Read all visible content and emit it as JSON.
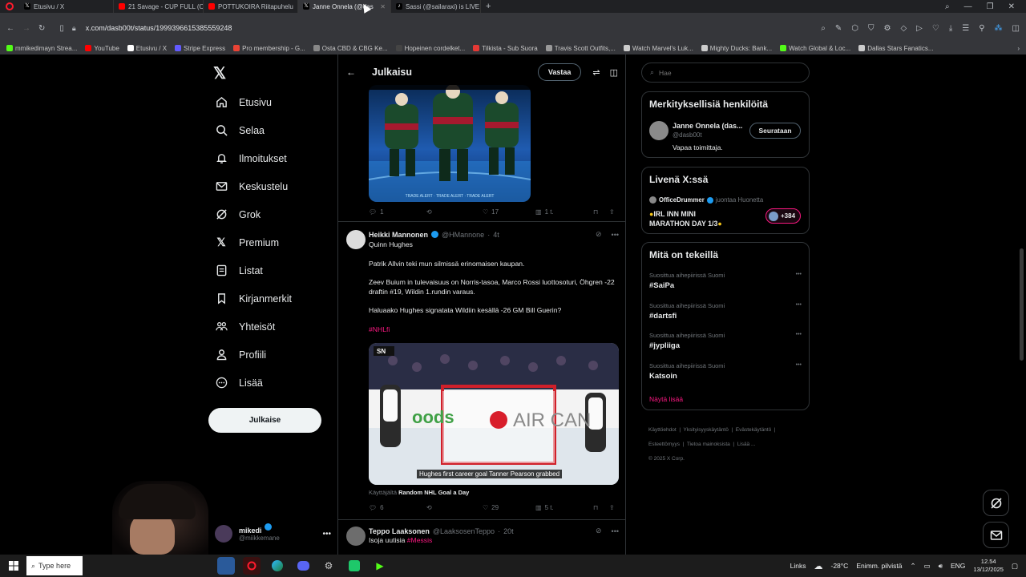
{
  "browser": {
    "tabs": [
      {
        "label": "Etusivu / X",
        "fav": "x-icon",
        "color": "#000000",
        "active": false
      },
      {
        "label": "21 Savage - CUP FULL (Offici",
        "fav": "youtube-icon",
        "color": "#ff0000",
        "active": false
      },
      {
        "label": "POTTUKOIRA Riitapuhelu",
        "fav": "youtube-icon",
        "color": "#ff0000",
        "active": false
      },
      {
        "label": "Janne Onnela (@dasb00t",
        "fav": "x-icon",
        "color": "#000000",
        "active": true
      },
      {
        "label": "Sassi (@sailaraxi) is LIVE",
        "fav": "tiktok-icon",
        "color": "#000000",
        "active": false
      }
    ],
    "url": "x.com/dasb00t/status/1999396615385559248",
    "bookmarks": [
      {
        "label": "mmikedimayn Strea...",
        "color": "#53fc18"
      },
      {
        "label": "YouTube",
        "color": "#ff0000"
      },
      {
        "label": "Etusivu / X",
        "color": "#ffffff"
      },
      {
        "label": "Stripe Express",
        "color": "#635bff"
      },
      {
        "label": "Pro membership - G...",
        "color": "#ea4335"
      },
      {
        "label": "Osta CBD & CBG Ke...",
        "color": "#888888"
      },
      {
        "label": "Hopeinen cordelket...",
        "color": "#444444"
      },
      {
        "label": "Tilkista - Sub Suora",
        "color": "#e53935"
      },
      {
        "label": "Travis Scott Outfits,...",
        "color": "#999999"
      },
      {
        "label": "Watch Marvel's Luk...",
        "color": "#cccccc"
      },
      {
        "label": "Mighty Ducks: Bank...",
        "color": "#cccccc"
      },
      {
        "label": "Watch Global & Loc...",
        "color": "#53fc18"
      },
      {
        "label": "Dallas Stars Fanatics...",
        "color": "#cccccc"
      }
    ]
  },
  "nav": {
    "items": [
      {
        "label": "Etusivu",
        "icon": "home-icon"
      },
      {
        "label": "Selaa",
        "icon": "search-icon"
      },
      {
        "label": "Ilmoitukset",
        "icon": "bell-icon"
      },
      {
        "label": "Keskustelu",
        "icon": "mail-icon"
      },
      {
        "label": "Grok",
        "icon": "grok-icon"
      },
      {
        "label": "Premium",
        "icon": "x-icon"
      },
      {
        "label": "Listat",
        "icon": "list-icon"
      },
      {
        "label": "Kirjanmerkit",
        "icon": "bookmark-icon"
      },
      {
        "label": "Yhteisöt",
        "icon": "communities-icon"
      },
      {
        "label": "Profiili",
        "icon": "profile-icon"
      },
      {
        "label": "Lisää",
        "icon": "more-icon"
      }
    ],
    "post_button": "Julkaise",
    "account": {
      "name": "mikedi",
      "handle": "@miikkemane"
    }
  },
  "header": {
    "title": "Julkaisu",
    "reply_button": "Vastaa"
  },
  "post1": {
    "replies": "1",
    "reposts": "",
    "likes": "17",
    "views": "1 t."
  },
  "post2": {
    "author": "Heikki Mannonen",
    "handle": "@HMannone",
    "time": "4t",
    "lines": [
      "Quinn Hughes",
      "Patrik Allvin teki mun silmissä erinomaisen kaupan.",
      "Zeev Buium in tulevaisuus on Norris-tasoa, Marco Rossi luottosoturi, Öhgren -22 draftin #19, Wildin 1.rundin varaus.",
      "Haluaako Hughes signatata Wildiin kesällä -26 GM Bill Guerin?"
    ],
    "hashtag": "#NHLfi",
    "video_caption": "Hughes first career goal Tanner Pearson grabbed",
    "video_sign": "AIR CAN",
    "video_ad": "oods",
    "video_logo": "SN",
    "source_prefix": "Käyttäjältä",
    "source_name": "Random NHL Goal a Day",
    "replies": "6",
    "reposts": "",
    "likes": "29",
    "views": "5 t."
  },
  "post3": {
    "author": "Teppo Laaksonen",
    "handle": "@LaaksosenTeppo",
    "time": "20t",
    "text": "Isoja uutisia",
    "hashtag": "#Messis"
  },
  "search": {
    "placeholder": "Hae"
  },
  "relevant": {
    "title": "Merkityksellisiä henkilöitä",
    "name": "Janne Onnela (das...",
    "handle": "@dasb00t",
    "bio": "Vapaa toimittaja.",
    "follow": "Seurataan"
  },
  "live": {
    "title": "Livenä X:ssä",
    "host": "OfficeDrummer",
    "meta": "juontaa Huonetta",
    "stream_title_1": "IRL INN MINI",
    "stream_title_2": "MARATHON DAY 1/3",
    "listeners": "+384"
  },
  "trends": {
    "title": "Mitä on tekeillä",
    "items": [
      {
        "meta": "Suosittua aihepiirissä Suomi",
        "name": "#SaiPa"
      },
      {
        "meta": "Suosittua aihepiirissä Suomi",
        "name": "#dartsfi"
      },
      {
        "meta": "Suosittua aihepiirissä Suomi",
        "name": "#jypliiga"
      },
      {
        "meta": "Suosittua aihepiirissä Suomi",
        "name": "Katsoin"
      }
    ],
    "show_more": "Näytä lisää"
  },
  "footer": {
    "links": [
      "Käyttöehdot",
      "Yksityisyyskäytäntö",
      "Evästekäytäntö",
      "Esteettömyys",
      "Tietoa mainoksista",
      "Lisää ..."
    ],
    "copyright": "© 2025 X Corp."
  },
  "taskbar": {
    "search_placeholder": "Type here",
    "links": "Links",
    "weather": "-28°C",
    "weather_desc": "Enimm. pilvistä",
    "lang": "ENG",
    "time": "12.54",
    "date": "13/12/2025"
  },
  "colors": {
    "accent": "#1d9bf0",
    "hashtag": "#f91880",
    "live": "#f91880"
  }
}
